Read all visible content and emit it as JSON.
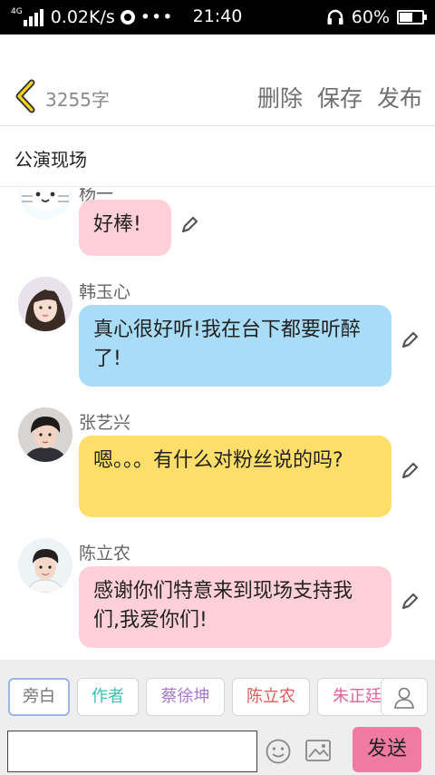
{
  "status_bar": {
    "network": "4G",
    "speed": "0.02K/s",
    "dots": "•••",
    "time": "21:40",
    "battery": "60%",
    "battery_level": 0.6
  },
  "header": {
    "word_count": "3255字",
    "actions": [
      "删除",
      "保存",
      "发布"
    ]
  },
  "scene": {
    "title": "公演现场"
  },
  "messages": [
    {
      "name": "杨一",
      "text": "好棒!",
      "color": "#ffd0da",
      "avatar": "cat-avatar"
    },
    {
      "name": "韩玉心",
      "text": "真心很好听!我在台下都要听醉了!",
      "color": "#a8dcf7",
      "avatar": "girl-avatar"
    },
    {
      "name": "张艺兴",
      "text": "嗯。。。有什么对粉丝说的吗?",
      "color": "#ffde6a",
      "avatar": "boy-avatar"
    },
    {
      "name": "陈立农",
      "text": "感谢你们特意来到现场支持我们,我爱你们!",
      "color": "#ffd0da",
      "avatar": "young-man-avatar"
    }
  ],
  "characters": [
    {
      "name": "旁白",
      "color": "#777777"
    },
    {
      "name": "作者",
      "color": "#3bbfb0"
    },
    {
      "name": "蔡徐坤",
      "color": "#a677cc"
    },
    {
      "name": "陈立农",
      "color": "#e05a5a"
    },
    {
      "name": "朱正廷",
      "color": "#e0649a"
    }
  ],
  "composer": {
    "placeholder": "",
    "send": "发送"
  },
  "colors": {
    "accent": "#f07aa1",
    "chip_active_border": "#9bb6e6"
  }
}
